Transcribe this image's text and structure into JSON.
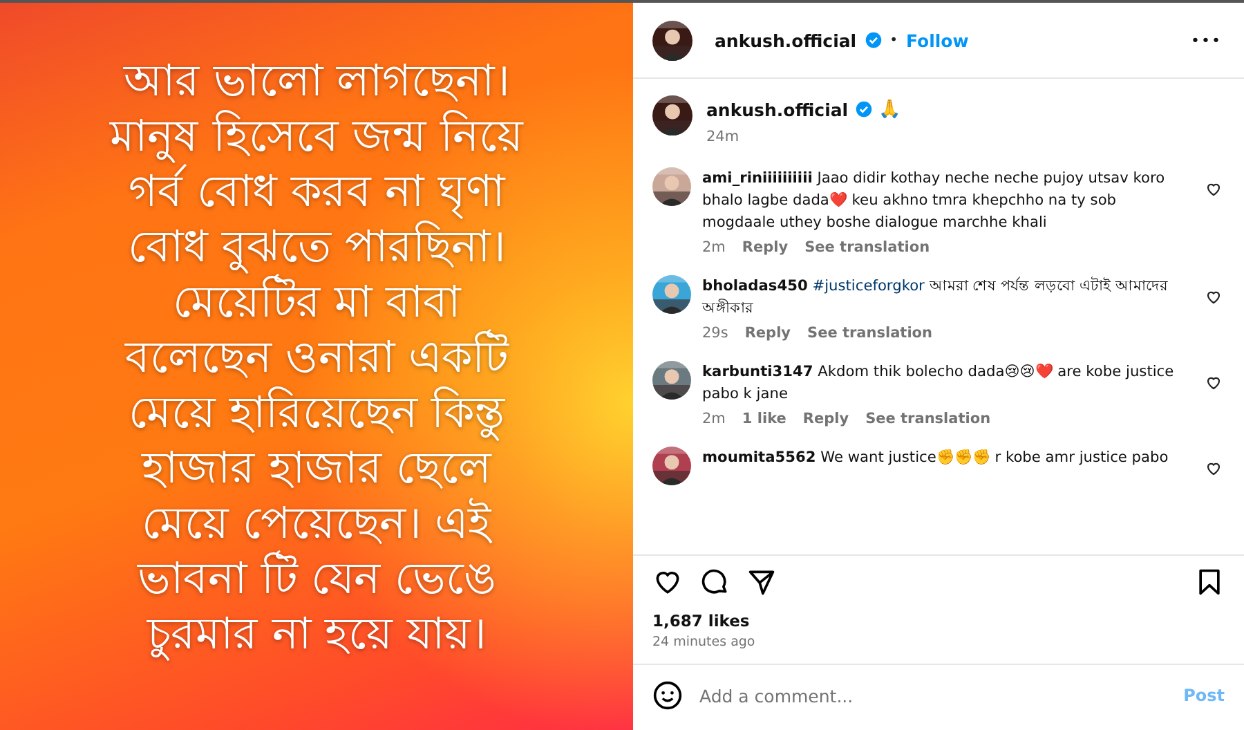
{
  "post_image": {
    "lines": [
      "আর ভালো লাগছেনা।",
      "মানুষ হিসেবে জন্ম নিয়ে",
      "গর্ব বোধ করব না ঘৃণা",
      "বোধ বুঝতে পারছিনা।",
      "মেয়েটির মা বাবা",
      "বলেছেন ওনারা একটি",
      "মেয়ে হারিয়েছেন কিন্তু",
      "হাজার হাজার ছেলে",
      "মেয়ে পেয়েছেন। এই",
      "ভাবনা টি যেন ভেঙে",
      "চুরমার না হয়ে যায়।"
    ]
  },
  "header": {
    "user": "ankush.official",
    "verified": true,
    "separator": "•",
    "follow": "Follow",
    "more": "•••"
  },
  "caption": {
    "user": "ankush.official",
    "verified": true,
    "text": "🙏",
    "time": "24m"
  },
  "comments": [
    {
      "user": "ami_riniiiiiiiiii",
      "text": "Jaao didir kothay neche neche pujoy utsav koro bhalo lagbe dada❤️ keu akhno tmra khepchho na ty sob mogdaale uthey boshe dialogue marchhe khali",
      "time": "2m",
      "reply": "Reply",
      "translate": "See translation"
    },
    {
      "user": "bholadas450",
      "hashtag": "#justiceforgkor",
      "text": "আমরা শেষ পর্যন্ত লড়বো এটাই আমাদের অঙ্গীকার",
      "time": "29s",
      "reply": "Reply",
      "translate": "See translation"
    },
    {
      "user": "karbunti3147",
      "text": "Akdom thik bolecho dada😢😢❤️ are kobe justice pabo k jane",
      "time": "2m",
      "likes": "1 like",
      "reply": "Reply",
      "translate": "See translation"
    },
    {
      "user": "moumita5562",
      "text": "We want justice✊✊✊ r kobe amr justice pabo"
    }
  ],
  "likes": "1,687 likes",
  "posted": "24 minutes ago",
  "comment_box": {
    "placeholder": "Add a comment...",
    "post": "Post",
    "disabled": true
  }
}
